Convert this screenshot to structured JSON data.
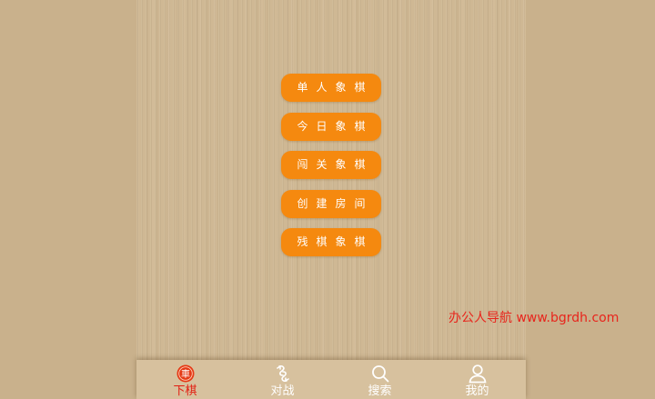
{
  "menu": {
    "items": [
      {
        "label": "单人象棋"
      },
      {
        "label": "今日象棋"
      },
      {
        "label": "闯关象棋"
      },
      {
        "label": "创建房间"
      },
      {
        "label": "残棋象棋"
      }
    ]
  },
  "watermark": {
    "text": "办公人导航 www.bgrdh.com"
  },
  "tabbar": {
    "active_index": 0,
    "tabs": [
      {
        "label": "下棋",
        "icon": "chariot-piece-icon",
        "icon_glyph": "車"
      },
      {
        "label": "对战",
        "icon": "battle-icon"
      },
      {
        "label": "搜索",
        "icon": "search-icon"
      },
      {
        "label": "我的",
        "icon": "user-icon"
      }
    ]
  },
  "colors": {
    "button": "#f5890f",
    "active": "#e21f12",
    "background": "#c9b18c",
    "tabbar": "#d7c19e",
    "watermark": "#e8251c"
  }
}
